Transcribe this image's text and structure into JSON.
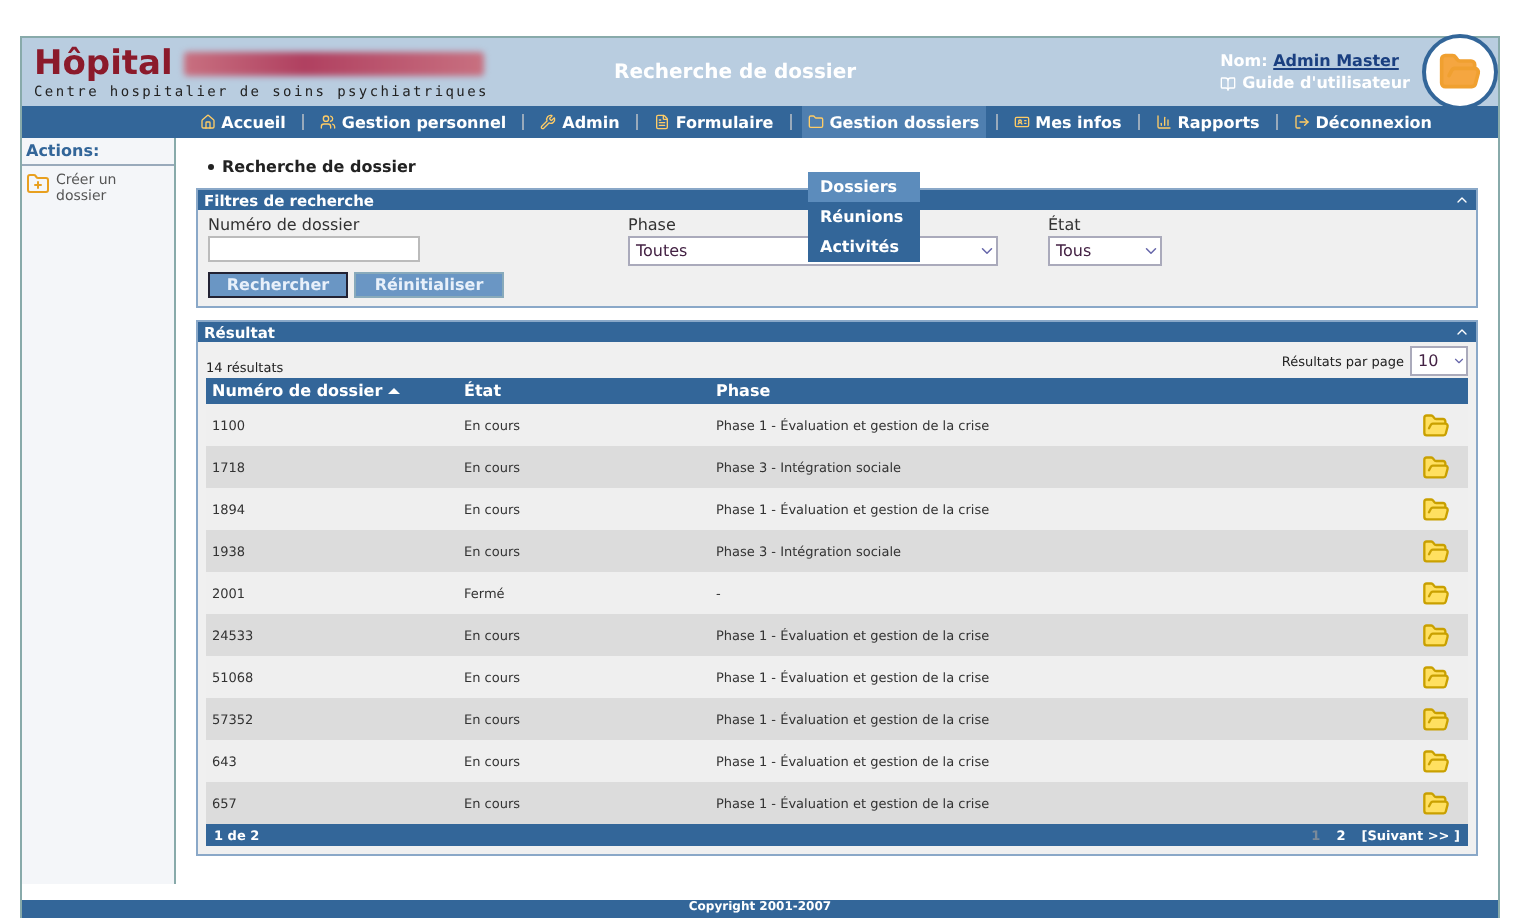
{
  "header": {
    "logo": "Hôpital",
    "subtitle": "Centre hospitalier de soins psychiatriques",
    "page_title": "Recherche de dossier",
    "user_label": "Nom:",
    "user_name": "Admin Master",
    "guide_link": "Guide d'utilisateur"
  },
  "nav": [
    {
      "label": "Accueil",
      "selected": false
    },
    {
      "label": "Gestion personnel",
      "selected": false
    },
    {
      "label": "Admin",
      "selected": false
    },
    {
      "label": "Formulaire",
      "selected": false
    },
    {
      "label": "Gestion dossiers",
      "selected": true
    },
    {
      "label": "Mes infos",
      "selected": false
    },
    {
      "label": "Rapports",
      "selected": false
    },
    {
      "label": "Déconnexion",
      "selected": false
    }
  ],
  "nav_menu": [
    {
      "label": "Dossiers",
      "selected": true
    },
    {
      "label": "Réunions",
      "selected": false
    },
    {
      "label": "Activités",
      "selected": false
    }
  ],
  "sidebar": {
    "heading": "Actions:",
    "items": [
      {
        "label": "Créer un dossier"
      }
    ]
  },
  "breadcrumb": "Recherche de dossier",
  "filters": {
    "title": "Filtres de recherche",
    "number_label": "Numéro de dossier",
    "phase_label": "Phase",
    "phase_value": "Toutes",
    "state_label": "État",
    "state_value": "Tous",
    "buttons": [
      "Rechercher",
      "Réinitialiser"
    ]
  },
  "results": {
    "title": "Résultat",
    "count": "14 résultats",
    "per_page_label": "Résultats par page",
    "per_page_value": "10",
    "columns": [
      {
        "label": "Numéro de dossier",
        "sorted": true
      },
      {
        "label": "État",
        "sorted": false
      },
      {
        "label": "Phase",
        "sorted": false
      }
    ],
    "rows": [
      {
        "number": "1100",
        "state": "En cours",
        "phase": "Phase 1 - Évaluation et gestion de la crise"
      },
      {
        "number": "1718",
        "state": "En cours",
        "phase": "Phase 3 - Intégration sociale"
      },
      {
        "number": "1894",
        "state": "En cours",
        "phase": "Phase 1 - Évaluation et gestion de la crise"
      },
      {
        "number": "1938",
        "state": "En cours",
        "phase": "Phase 3 - Intégration sociale"
      },
      {
        "number": "2001",
        "state": "Fermé",
        "phase": "-"
      },
      {
        "number": "24533",
        "state": "En cours",
        "phase": "Phase 1 - Évaluation et gestion de la crise"
      },
      {
        "number": "51068",
        "state": "En cours",
        "phase": "Phase 1 - Évaluation et gestion de la crise"
      },
      {
        "number": "57352",
        "state": "En cours",
        "phase": "Phase 1 - Évaluation et gestion de la crise"
      },
      {
        "number": "643",
        "state": "En cours",
        "phase": "Phase 1 - Évaluation et gestion de la crise"
      },
      {
        "number": "657",
        "state": "En cours",
        "phase": "Phase 1 - Évaluation et gestion de la crise"
      }
    ],
    "footer": {
      "range": "1 de 2",
      "pages": [
        {
          "label": "1",
          "selected": true
        },
        {
          "label": "2",
          "selected": false
        }
      ],
      "next": "[Suivant >> ]"
    }
  },
  "footer": {
    "copyright": "Copyright 2001-2007"
  }
}
